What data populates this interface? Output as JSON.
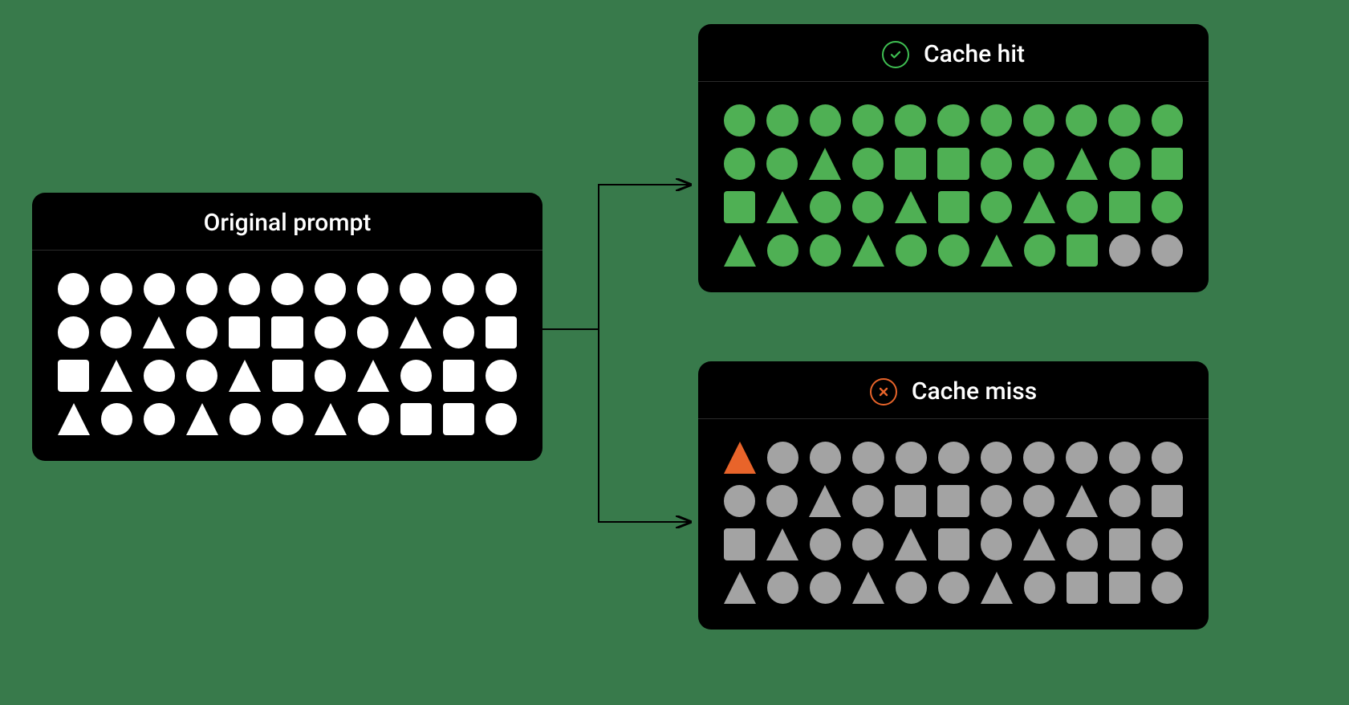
{
  "colors": {
    "background": "#387a4b",
    "panel": "#000000",
    "white": "#ffffff",
    "green": "#4fb054",
    "gray": "#a3a3a3",
    "orange": "#e8642a",
    "check_icon": "#3fbf52"
  },
  "panels": {
    "original": {
      "title": "Original prompt",
      "rows": [
        [
          {
            "s": "circle",
            "c": "white"
          },
          {
            "s": "circle",
            "c": "white"
          },
          {
            "s": "circle",
            "c": "white"
          },
          {
            "s": "circle",
            "c": "white"
          },
          {
            "s": "circle",
            "c": "white"
          },
          {
            "s": "circle",
            "c": "white"
          },
          {
            "s": "circle",
            "c": "white"
          },
          {
            "s": "circle",
            "c": "white"
          },
          {
            "s": "circle",
            "c": "white"
          },
          {
            "s": "circle",
            "c": "white"
          },
          {
            "s": "circle",
            "c": "white"
          }
        ],
        [
          {
            "s": "circle",
            "c": "white"
          },
          {
            "s": "circle",
            "c": "white"
          },
          {
            "s": "triangle",
            "c": "white"
          },
          {
            "s": "circle",
            "c": "white"
          },
          {
            "s": "square",
            "c": "white"
          },
          {
            "s": "square",
            "c": "white"
          },
          {
            "s": "circle",
            "c": "white"
          },
          {
            "s": "circle",
            "c": "white"
          },
          {
            "s": "triangle",
            "c": "white"
          },
          {
            "s": "circle",
            "c": "white"
          },
          {
            "s": "square",
            "c": "white"
          }
        ],
        [
          {
            "s": "square",
            "c": "white"
          },
          {
            "s": "triangle",
            "c": "white"
          },
          {
            "s": "circle",
            "c": "white"
          },
          {
            "s": "circle",
            "c": "white"
          },
          {
            "s": "triangle",
            "c": "white"
          },
          {
            "s": "square",
            "c": "white"
          },
          {
            "s": "circle",
            "c": "white"
          },
          {
            "s": "triangle",
            "c": "white"
          },
          {
            "s": "circle",
            "c": "white"
          },
          {
            "s": "square",
            "c": "white"
          },
          {
            "s": "circle",
            "c": "white"
          }
        ],
        [
          {
            "s": "triangle",
            "c": "white"
          },
          {
            "s": "circle",
            "c": "white"
          },
          {
            "s": "circle",
            "c": "white"
          },
          {
            "s": "triangle",
            "c": "white"
          },
          {
            "s": "circle",
            "c": "white"
          },
          {
            "s": "circle",
            "c": "white"
          },
          {
            "s": "triangle",
            "c": "white"
          },
          {
            "s": "circle",
            "c": "white"
          },
          {
            "s": "square",
            "c": "white"
          },
          {
            "s": "square",
            "c": "white"
          },
          {
            "s": "circle",
            "c": "white"
          }
        ]
      ]
    },
    "hit": {
      "title": "Cache hit",
      "icon": "check",
      "rows": [
        [
          {
            "s": "circle",
            "c": "green"
          },
          {
            "s": "circle",
            "c": "green"
          },
          {
            "s": "circle",
            "c": "green"
          },
          {
            "s": "circle",
            "c": "green"
          },
          {
            "s": "circle",
            "c": "green"
          },
          {
            "s": "circle",
            "c": "green"
          },
          {
            "s": "circle",
            "c": "green"
          },
          {
            "s": "circle",
            "c": "green"
          },
          {
            "s": "circle",
            "c": "green"
          },
          {
            "s": "circle",
            "c": "green"
          },
          {
            "s": "circle",
            "c": "green"
          }
        ],
        [
          {
            "s": "circle",
            "c": "green"
          },
          {
            "s": "circle",
            "c": "green"
          },
          {
            "s": "triangle",
            "c": "green"
          },
          {
            "s": "circle",
            "c": "green"
          },
          {
            "s": "square",
            "c": "green"
          },
          {
            "s": "square",
            "c": "green"
          },
          {
            "s": "circle",
            "c": "green"
          },
          {
            "s": "circle",
            "c": "green"
          },
          {
            "s": "triangle",
            "c": "green"
          },
          {
            "s": "circle",
            "c": "green"
          },
          {
            "s": "square",
            "c": "green"
          }
        ],
        [
          {
            "s": "square",
            "c": "green"
          },
          {
            "s": "triangle",
            "c": "green"
          },
          {
            "s": "circle",
            "c": "green"
          },
          {
            "s": "circle",
            "c": "green"
          },
          {
            "s": "triangle",
            "c": "green"
          },
          {
            "s": "square",
            "c": "green"
          },
          {
            "s": "circle",
            "c": "green"
          },
          {
            "s": "triangle",
            "c": "green"
          },
          {
            "s": "circle",
            "c": "green"
          },
          {
            "s": "square",
            "c": "green"
          },
          {
            "s": "circle",
            "c": "green"
          }
        ],
        [
          {
            "s": "triangle",
            "c": "green"
          },
          {
            "s": "circle",
            "c": "green"
          },
          {
            "s": "circle",
            "c": "green"
          },
          {
            "s": "triangle",
            "c": "green"
          },
          {
            "s": "circle",
            "c": "green"
          },
          {
            "s": "circle",
            "c": "green"
          },
          {
            "s": "triangle",
            "c": "green"
          },
          {
            "s": "circle",
            "c": "green"
          },
          {
            "s": "square",
            "c": "green"
          },
          {
            "s": "circle",
            "c": "gray"
          },
          {
            "s": "circle",
            "c": "gray"
          }
        ]
      ]
    },
    "miss": {
      "title": "Cache miss",
      "icon": "x",
      "rows": [
        [
          {
            "s": "triangle",
            "c": "orange"
          },
          {
            "s": "circle",
            "c": "gray"
          },
          {
            "s": "circle",
            "c": "gray"
          },
          {
            "s": "circle",
            "c": "gray"
          },
          {
            "s": "circle",
            "c": "gray"
          },
          {
            "s": "circle",
            "c": "gray"
          },
          {
            "s": "circle",
            "c": "gray"
          },
          {
            "s": "circle",
            "c": "gray"
          },
          {
            "s": "circle",
            "c": "gray"
          },
          {
            "s": "circle",
            "c": "gray"
          },
          {
            "s": "circle",
            "c": "gray"
          }
        ],
        [
          {
            "s": "circle",
            "c": "gray"
          },
          {
            "s": "circle",
            "c": "gray"
          },
          {
            "s": "triangle",
            "c": "gray"
          },
          {
            "s": "circle",
            "c": "gray"
          },
          {
            "s": "square",
            "c": "gray"
          },
          {
            "s": "square",
            "c": "gray"
          },
          {
            "s": "circle",
            "c": "gray"
          },
          {
            "s": "circle",
            "c": "gray"
          },
          {
            "s": "triangle",
            "c": "gray"
          },
          {
            "s": "circle",
            "c": "gray"
          },
          {
            "s": "square",
            "c": "gray"
          }
        ],
        [
          {
            "s": "square",
            "c": "gray"
          },
          {
            "s": "triangle",
            "c": "gray"
          },
          {
            "s": "circle",
            "c": "gray"
          },
          {
            "s": "circle",
            "c": "gray"
          },
          {
            "s": "triangle",
            "c": "gray"
          },
          {
            "s": "square",
            "c": "gray"
          },
          {
            "s": "circle",
            "c": "gray"
          },
          {
            "s": "triangle",
            "c": "gray"
          },
          {
            "s": "circle",
            "c": "gray"
          },
          {
            "s": "square",
            "c": "gray"
          },
          {
            "s": "circle",
            "c": "gray"
          }
        ],
        [
          {
            "s": "triangle",
            "c": "gray"
          },
          {
            "s": "circle",
            "c": "gray"
          },
          {
            "s": "circle",
            "c": "gray"
          },
          {
            "s": "triangle",
            "c": "gray"
          },
          {
            "s": "circle",
            "c": "gray"
          },
          {
            "s": "circle",
            "c": "gray"
          },
          {
            "s": "triangle",
            "c": "gray"
          },
          {
            "s": "circle",
            "c": "gray"
          },
          {
            "s": "square",
            "c": "gray"
          },
          {
            "s": "square",
            "c": "gray"
          },
          {
            "s": "circle",
            "c": "gray"
          }
        ]
      ]
    }
  }
}
